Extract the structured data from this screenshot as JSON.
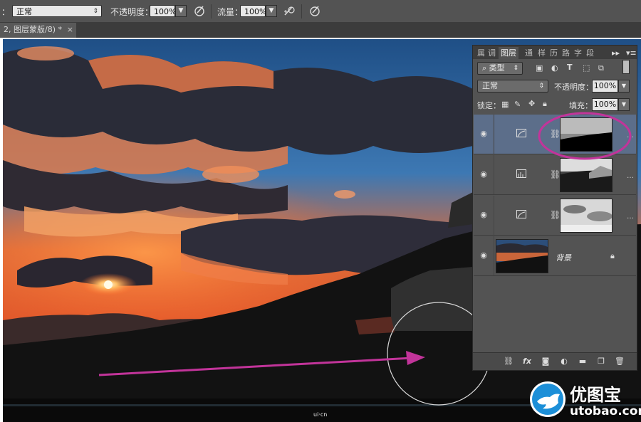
{
  "options_bar": {
    "mode_prefix": "：",
    "mode_value": "正常",
    "opacity_label": "不透明度：",
    "opacity_value": "100%",
    "flow_label": "流量：",
    "flow_value": "100%"
  },
  "document_tab": {
    "title": "2, 图层蒙版/8) *",
    "close": "×"
  },
  "layers_panel": {
    "tabs": [
      "属",
      "调",
      "图层",
      "通",
      "样",
      "历",
      "路",
      "字",
      "段"
    ],
    "active_tab": "图层",
    "filter_label": "类型",
    "blend_mode": "正常",
    "opacity_label": "不透明度：",
    "opacity_value": "100%",
    "lock_label": "锁定：",
    "fill_label": "填充：",
    "fill_value": "100%",
    "layers": [
      {
        "type": "curves-adjustment",
        "selected": true,
        "has_mask": true,
        "name": ""
      },
      {
        "type": "levels-adjustment",
        "selected": false,
        "has_mask": true,
        "name": ""
      },
      {
        "type": "curves-adjustment",
        "selected": false,
        "has_mask": true,
        "name": ""
      },
      {
        "type": "background",
        "selected": false,
        "has_mask": false,
        "name": "背景"
      }
    ],
    "more_glyph": "…"
  },
  "annotations": {
    "highlight_color": "#c2349a",
    "arrow_color": "#c2349a"
  },
  "watermark": {
    "brand_cn": "优图宝",
    "brand_url": "utobao.com",
    "small_mark": "ui·cn"
  }
}
